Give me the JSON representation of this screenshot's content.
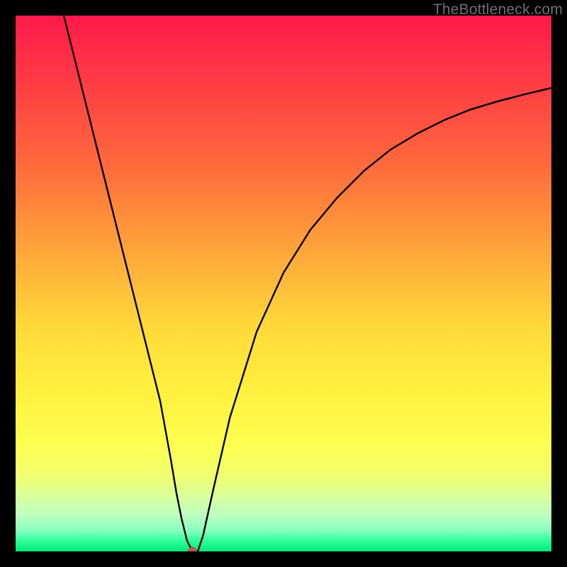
{
  "watermark": "TheBottleneck.com",
  "chart_data": {
    "type": "line",
    "title": "",
    "xlabel": "",
    "ylabel": "",
    "xlim": [
      0,
      100
    ],
    "ylim": [
      0,
      100
    ],
    "grid": false,
    "background_gradient": {
      "top": "#ff1a4b",
      "bottom": "#00e87a"
    },
    "marker": {
      "x": 33,
      "y": 0,
      "color": "#b85a5a"
    },
    "series": [
      {
        "name": "curve",
        "color": "#000000",
        "x": [
          9,
          12,
          15,
          18,
          21,
          24,
          27,
          29,
          30,
          31,
          32,
          33,
          34,
          35,
          37,
          40,
          45,
          50,
          55,
          60,
          65,
          70,
          75,
          80,
          85,
          90,
          95,
          100
        ],
        "y": [
          100,
          88,
          76,
          64,
          52,
          40,
          28,
          17,
          11,
          6,
          2,
          0,
          0,
          3,
          12,
          25,
          41,
          52,
          60,
          66,
          71,
          75,
          78,
          80.5,
          82.5,
          84,
          85.3,
          86.5
        ]
      }
    ]
  }
}
